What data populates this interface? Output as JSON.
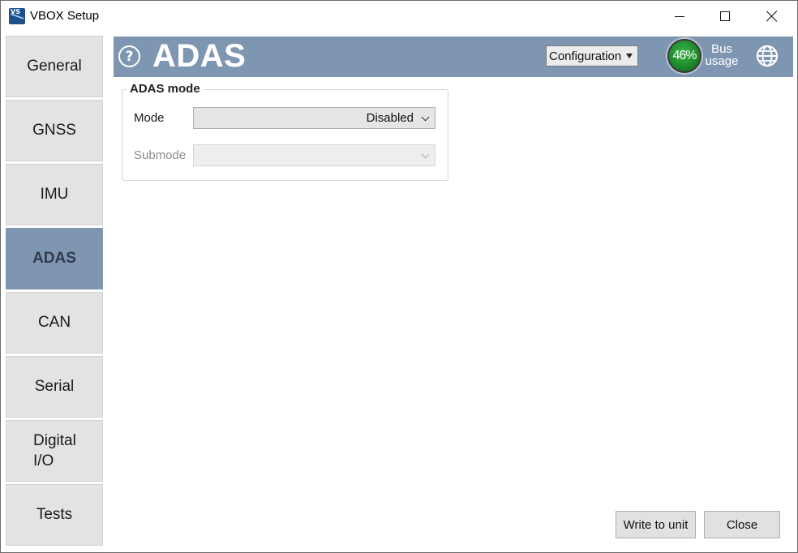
{
  "window": {
    "title": "VBOX Setup",
    "icon_text": "VS"
  },
  "sidebar": {
    "items": [
      {
        "label": "General",
        "active": false
      },
      {
        "label": "GNSS",
        "active": false
      },
      {
        "label": "IMU",
        "active": false
      },
      {
        "label": "ADAS",
        "active": true
      },
      {
        "label": "CAN",
        "active": false
      },
      {
        "label": "Serial",
        "active": false
      },
      {
        "label_line1": "Digital",
        "label_line2": "I/O",
        "active": false
      },
      {
        "label": "Tests",
        "active": false
      }
    ]
  },
  "header": {
    "help_icon_text": "?",
    "title": "ADAS",
    "config_select": {
      "selected": "Configuration"
    },
    "bus_usage": {
      "percent_text": "46%",
      "label_line1": "Bus",
      "label_line2": "usage"
    },
    "icons": {
      "help": "help-icon",
      "globe": "globe-icon"
    }
  },
  "adas_mode": {
    "group_title": "ADAS mode",
    "mode_label": "Mode",
    "mode_value": "Disabled",
    "submode_label": "Submode",
    "submode_value": ""
  },
  "footer": {
    "write_label": "Write to unit",
    "close_label": "Close"
  },
  "colors": {
    "accent": "#7f96b2",
    "sidebar_bg": "#e3e3e3",
    "gauge_green": "#1f8a2b"
  }
}
